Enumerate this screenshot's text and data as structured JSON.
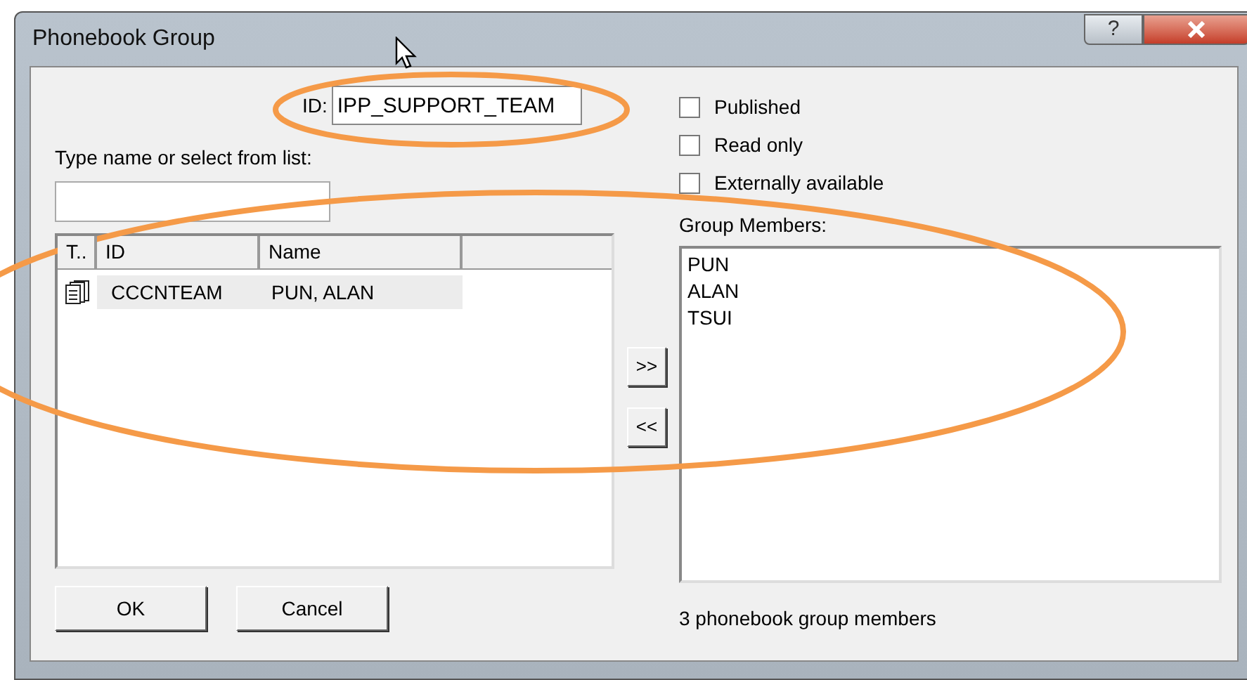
{
  "window": {
    "title": "Phonebook Group",
    "help_button": "?"
  },
  "id_field": {
    "label": "ID:",
    "value": "IPP_SUPPORT_TEAM"
  },
  "checkboxes": [
    {
      "label": "Published",
      "checked": false
    },
    {
      "label": "Read only",
      "checked": false
    },
    {
      "label": "Externally available",
      "checked": false
    }
  ],
  "search": {
    "label": "Type name or select from list:"
  },
  "list": {
    "columns": [
      "T..",
      "ID",
      "Name"
    ],
    "rows": [
      {
        "id": "CCCNTEAM",
        "name": "PUN, ALAN",
        "selected": true
      }
    ]
  },
  "members": {
    "label": "Group Members:",
    "items": [
      "PUN",
      "ALAN",
      "TSUI"
    ]
  },
  "move_buttons": [
    ">>",
    "<<"
  ],
  "buttons": [
    "OK",
    "Cancel"
  ],
  "status": "3 phonebook group members"
}
